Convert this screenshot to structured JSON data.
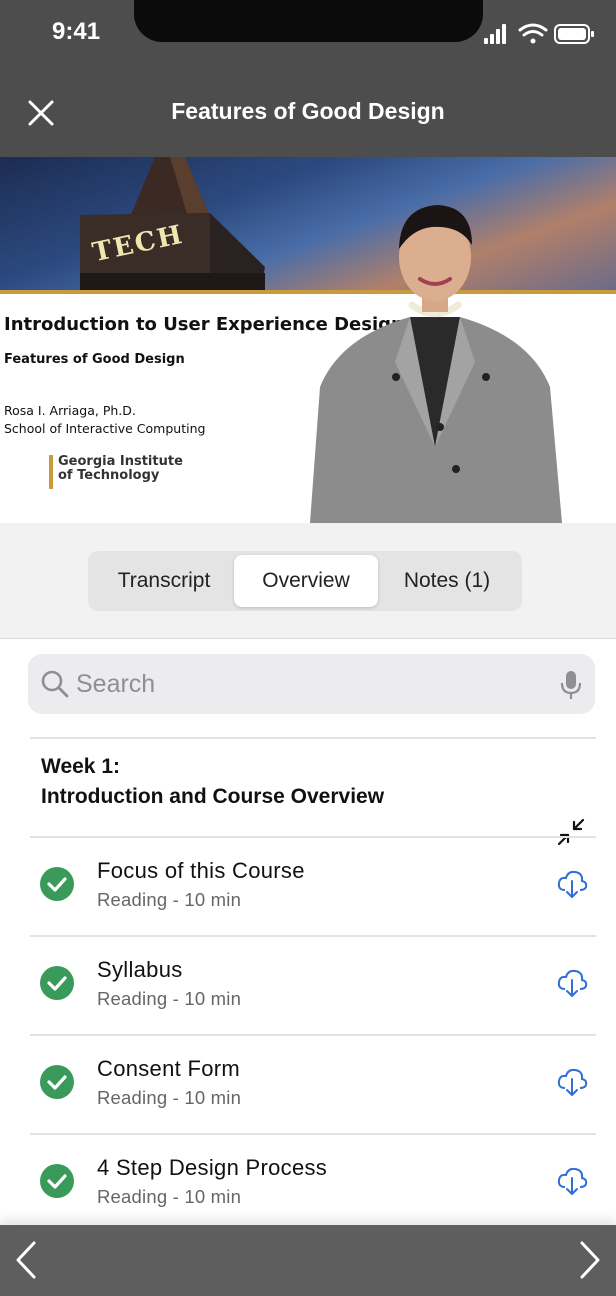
{
  "status_bar": {
    "time": "9:41",
    "icons": [
      "signal-icon",
      "wifi-icon",
      "battery-icon"
    ]
  },
  "header": {
    "title": "Features of Good Design",
    "close_icon": "close-icon"
  },
  "video_slide": {
    "course_title": "Introduction to User Experience Design",
    "lecture_title": "Features of Good Design",
    "author_name": "Rosa I. Arriaga, Ph.D.",
    "author_school": "School of Interactive Computing",
    "logo_text": "Georgia Institute of Technology",
    "tower_text": "TECH"
  },
  "tabs": [
    {
      "label": "Transcript",
      "active": false
    },
    {
      "label": "Overview",
      "active": true
    },
    {
      "label": "Notes (1)",
      "active": false
    }
  ],
  "search": {
    "placeholder": "Search",
    "value": ""
  },
  "week": {
    "label": "Week 1:",
    "title": "Introduction and Course Overview"
  },
  "items": [
    {
      "title": "Focus of this Course",
      "subtitle": "Reading - 10 min",
      "completed": true
    },
    {
      "title": "Syllabus",
      "subtitle": "Reading - 10 min",
      "completed": true
    },
    {
      "title": "Consent Form",
      "subtitle": "Reading - 10 min",
      "completed": true
    },
    {
      "title": "4 Step Design Process",
      "subtitle": "Reading - 10 min",
      "completed": true
    }
  ],
  "colors": {
    "header_bg": "#4d4d4d",
    "bottom_bar_bg": "#5e5e5e",
    "check_green": "#3a9a5a",
    "download_blue": "#2f6fd6",
    "gold_accent": "#c89b3c"
  }
}
